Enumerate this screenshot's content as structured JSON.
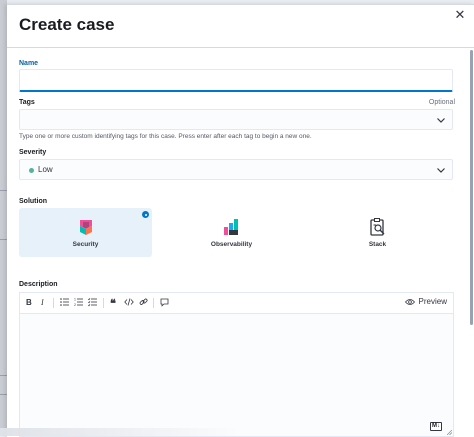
{
  "flyout": {
    "title": "Create case",
    "close_icon": "close-icon"
  },
  "form": {
    "name": {
      "label": "Name",
      "value": "",
      "placeholder": ""
    },
    "tags": {
      "label": "Tags",
      "optional": "Optional",
      "help": "Type one or more custom identifying tags for this case. Press enter after each tag to begin a new one."
    },
    "severity": {
      "label": "Severity",
      "value": "Low",
      "dot_color": "#54b399"
    },
    "solution": {
      "label": "Solution",
      "options": [
        {
          "label": "Security",
          "icon": "security-logo-icon",
          "selected": true
        },
        {
          "label": "Observability",
          "icon": "observability-logo-icon",
          "selected": false
        },
        {
          "label": "Stack",
          "icon": "stack-management-icon",
          "selected": false
        }
      ]
    },
    "description": {
      "label": "Description",
      "toolbar": {
        "bold": "B",
        "italic": "I",
        "preview": "Preview"
      },
      "markdown_badge": "M↓"
    }
  },
  "colors": {
    "accent": "#0077cc",
    "selected_bg": "#e6f1fa"
  }
}
